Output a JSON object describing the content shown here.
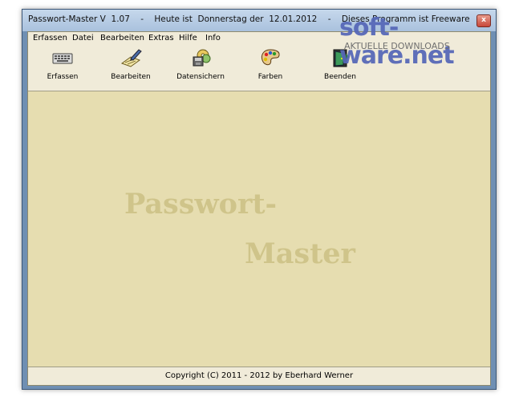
{
  "window": {
    "title": "Passwort-Master V  1.07    -    Heute ist  Donnerstag der  12.01.2012    -    Dieses Programm ist Freeware",
    "close_label": "x"
  },
  "menu": {
    "items": [
      "Erfassen",
      "Datei",
      "Bearbeiten",
      "Extras",
      "Hilfe",
      "Info"
    ]
  },
  "toolbar": {
    "items": [
      {
        "label": "Erfassen",
        "icon": "keyboard-icon"
      },
      {
        "label": "Bearbeiten",
        "icon": "edit-document-icon"
      },
      {
        "label": "Datensichern",
        "icon": "backup-disks-icon"
      },
      {
        "label": "Farben",
        "icon": "palette-icon"
      },
      {
        "label": "Beenden",
        "icon": "exit-door-icon"
      }
    ]
  },
  "main": {
    "brand_line1": "Passwort-",
    "brand_line2": "Master"
  },
  "status": {
    "copyright": "Copyright (C)  2011 - 2012 by Eberhard Werner"
  },
  "watermark": {
    "logo_text": "soft-ware.net",
    "tagline": "AKTUELLE DOWNLOADS"
  },
  "colors": {
    "client_background": "#e6ddb0",
    "bars": "#f0ebd9",
    "brand_text": "#cfc48a",
    "frame": "#6f8fb3"
  }
}
